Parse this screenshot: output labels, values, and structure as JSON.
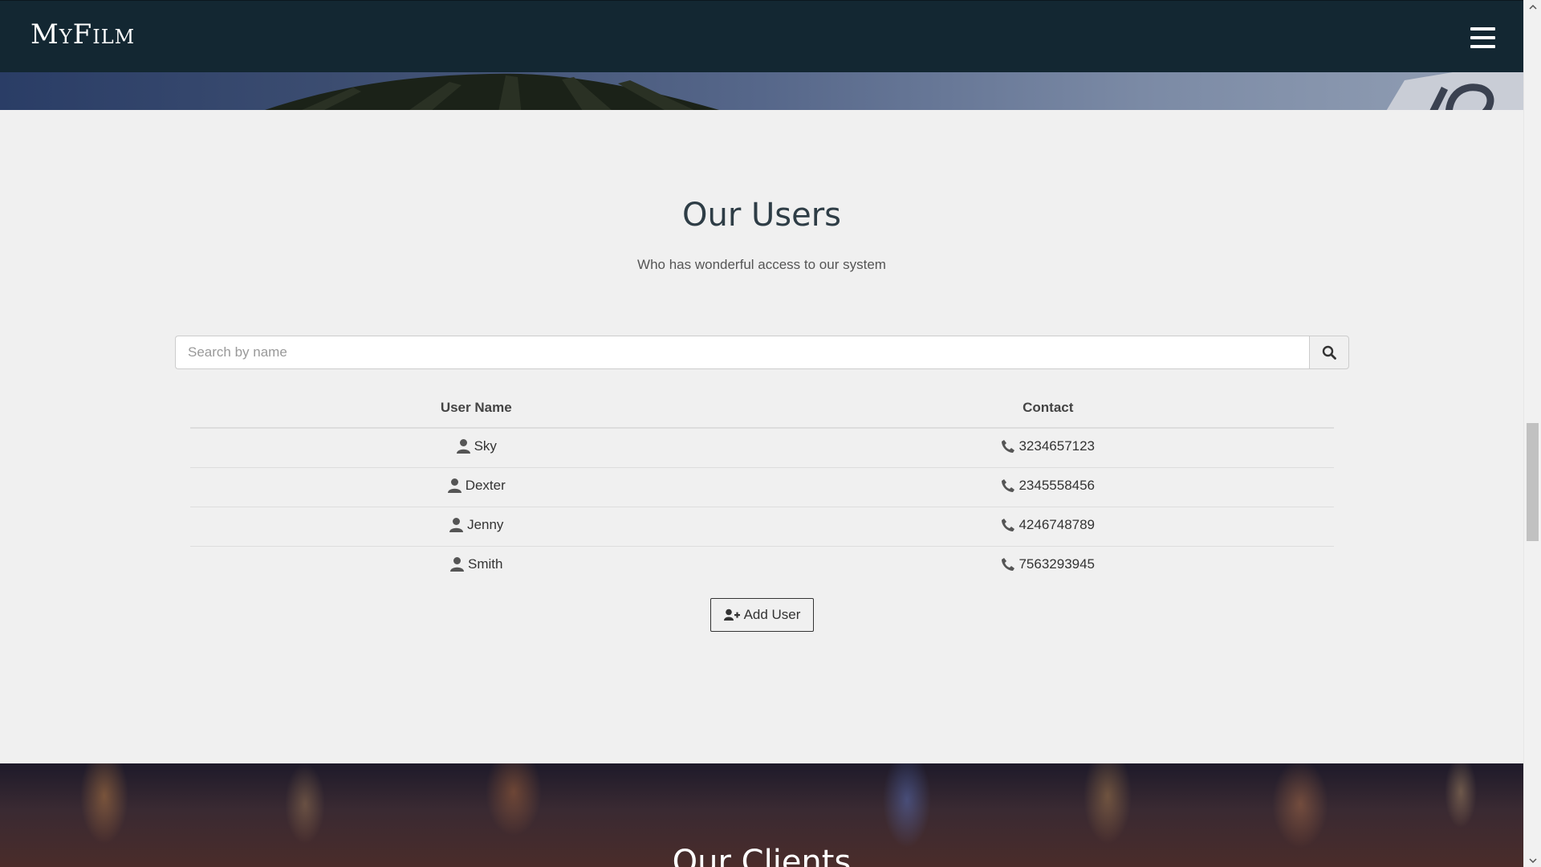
{
  "navbar": {
    "brand": "MyFilm",
    "menu_icon": "hamburger-menu-icon"
  },
  "users_section": {
    "title": "Our Users",
    "subtitle": "Who has wonderful access to our system",
    "search": {
      "placeholder": "Search by name",
      "value": "",
      "button_icon": "search-icon"
    },
    "table": {
      "headers": [
        "User Name",
        "Contact"
      ],
      "rows": [
        {
          "name": "Sky",
          "contact": "3234657123"
        },
        {
          "name": "Dexter",
          "contact": "2345558456"
        },
        {
          "name": "Jenny",
          "contact": "4246748789"
        },
        {
          "name": "Smith",
          "contact": "7563293945"
        }
      ],
      "name_icon": "user-icon",
      "contact_icon": "phone-icon"
    },
    "add_button": {
      "label": "Add User",
      "icon": "user-plus-icon"
    }
  },
  "clients_section": {
    "title": "Our Clients"
  },
  "colors": {
    "navbar_bg": "#132732",
    "page_bg": "#f0f0f0",
    "title_text": "#2e3d46"
  }
}
